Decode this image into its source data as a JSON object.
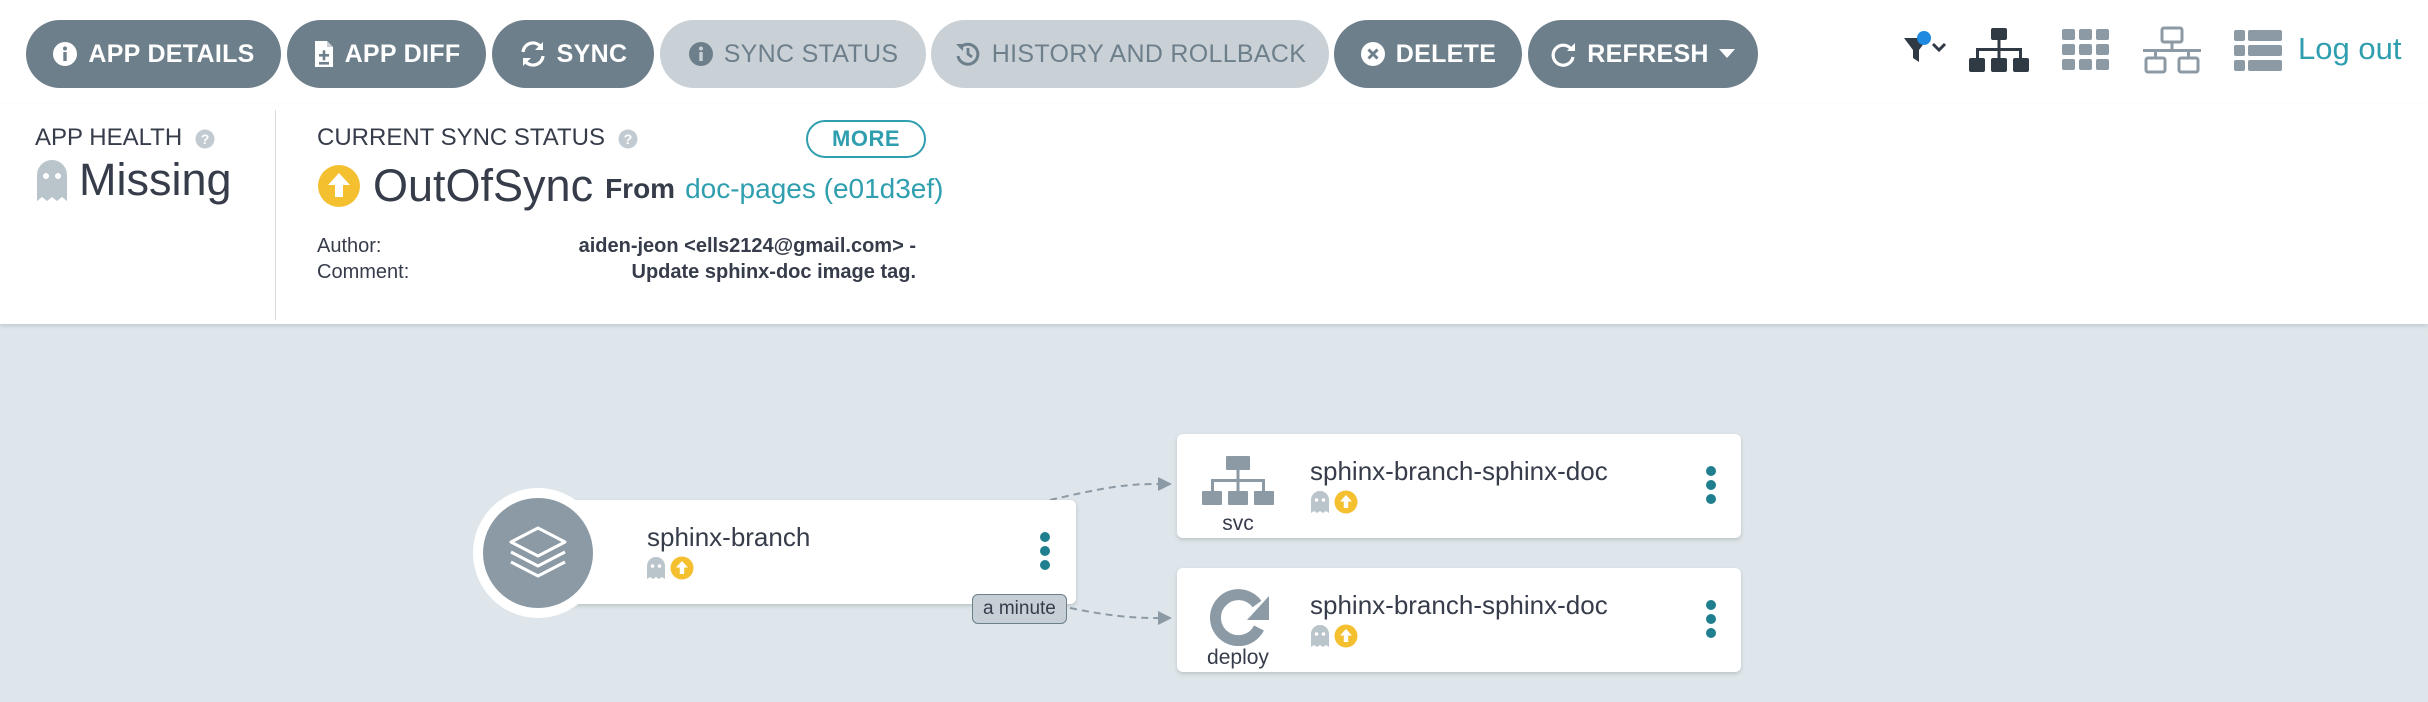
{
  "toolbar": {
    "app_details": "APP DETAILS",
    "app_diff": "APP DIFF",
    "sync": "SYNC",
    "sync_status": "SYNC STATUS",
    "history_rollback": "HISTORY AND ROLLBACK",
    "delete": "DELETE",
    "refresh": "REFRESH",
    "logout": "Log out"
  },
  "status": {
    "health_label": "APP HEALTH",
    "health_value": "Missing",
    "sync_label": "CURRENT SYNC STATUS",
    "more_label": "MORE",
    "sync_value": "OutOfSync",
    "from_label": "From",
    "revision": "doc-pages (e01d3ef)",
    "author_key": "Author:",
    "author_value": "aiden-jeon <ells2124@gmail.com> -",
    "comment_key": "Comment:",
    "comment_value": "Update sphinx-doc image tag."
  },
  "graph": {
    "app_node": {
      "name": "sphinx-branch",
      "age": "a minute"
    },
    "svc_node": {
      "name": "sphinx-branch-sphinx-doc",
      "kind": "svc"
    },
    "deploy_node": {
      "name": "sphinx-branch-sphinx-doc",
      "kind": "deploy"
    }
  },
  "colors": {
    "primary_button": "#6d7f8b",
    "disabled_button": "#c9d1d7",
    "accent_teal": "#2f9fb0",
    "out_of_sync": "#f4c030",
    "missing_ghost": "#b9c4cb",
    "graph_background": "#dee6eb"
  },
  "icons": {
    "app_details": "info-circle-icon",
    "app_diff": "file-diff-icon",
    "sync": "sync-arrows-icon",
    "sync_status": "info-circle-icon",
    "history": "history-icon",
    "delete": "times-circle-icon",
    "refresh": "redo-icon",
    "filter": "filter-icon",
    "view_tree": "tree-view-icon",
    "view_pods": "grid-view-icon",
    "view_network": "network-view-icon",
    "view_list": "list-view-icon",
    "health": "ghost-icon",
    "sync_state": "arrow-circle-up-icon"
  }
}
